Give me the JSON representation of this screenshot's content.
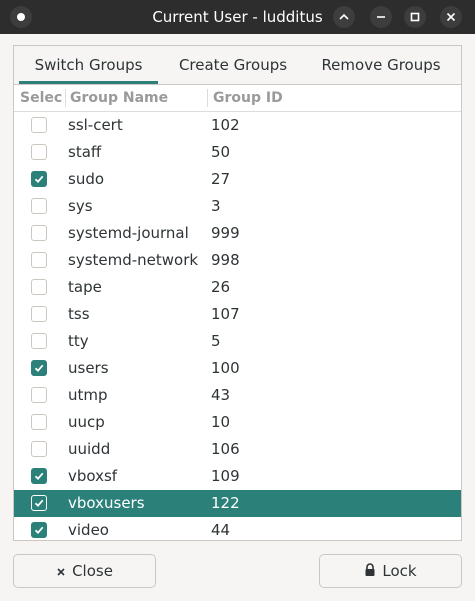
{
  "window": {
    "title": "Current User - ludditus"
  },
  "tabs": [
    {
      "label": "Switch Groups",
      "active": true
    },
    {
      "label": "Create Groups",
      "active": false
    },
    {
      "label": "Remove Groups",
      "active": false
    }
  ],
  "table": {
    "columns": [
      "Selec",
      "Group Name",
      "Group ID"
    ],
    "rows": [
      {
        "checked": false,
        "name": "ssl-cert",
        "id": "102",
        "selected": false
      },
      {
        "checked": false,
        "name": "staff",
        "id": "50",
        "selected": false
      },
      {
        "checked": true,
        "name": "sudo",
        "id": "27",
        "selected": false
      },
      {
        "checked": false,
        "name": "sys",
        "id": "3",
        "selected": false
      },
      {
        "checked": false,
        "name": "systemd-journal",
        "id": "999",
        "selected": false
      },
      {
        "checked": false,
        "name": "systemd-network",
        "id": "998",
        "selected": false
      },
      {
        "checked": false,
        "name": "tape",
        "id": "26",
        "selected": false
      },
      {
        "checked": false,
        "name": "tss",
        "id": "107",
        "selected": false
      },
      {
        "checked": false,
        "name": "tty",
        "id": "5",
        "selected": false
      },
      {
        "checked": true,
        "name": "users",
        "id": "100",
        "selected": false
      },
      {
        "checked": false,
        "name": "utmp",
        "id": "43",
        "selected": false
      },
      {
        "checked": false,
        "name": "uucp",
        "id": "10",
        "selected": false
      },
      {
        "checked": false,
        "name": "uuidd",
        "id": "106",
        "selected": false
      },
      {
        "checked": true,
        "name": "vboxsf",
        "id": "109",
        "selected": false
      },
      {
        "checked": true,
        "name": "vboxusers",
        "id": "122",
        "selected": true
      },
      {
        "checked": true,
        "name": "video",
        "id": "44",
        "selected": false
      }
    ]
  },
  "footer": {
    "close_label": "Close",
    "lock_label": "Lock"
  },
  "colors": {
    "accent": "#2b8079",
    "titlebar": "#2d2d2d"
  }
}
